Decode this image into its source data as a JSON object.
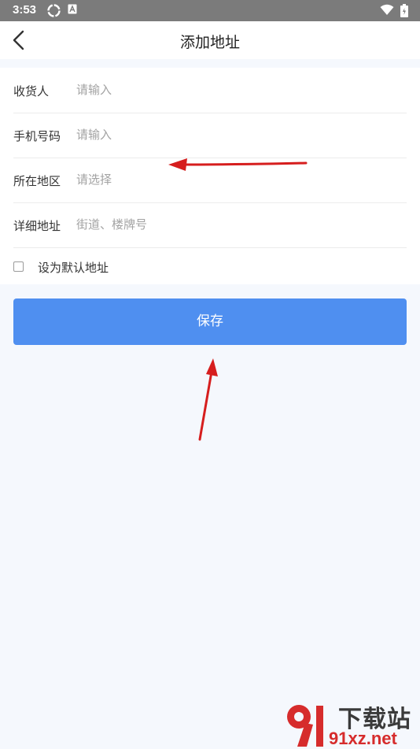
{
  "status_bar": {
    "time": "3:53"
  },
  "header": {
    "title": "添加地址"
  },
  "form": {
    "rows": [
      {
        "label": "收货人",
        "placeholder": "请输入"
      },
      {
        "label": "手机号码",
        "placeholder": "请输入"
      },
      {
        "label": "所在地区",
        "placeholder": "请选择"
      },
      {
        "label": "详细地址",
        "placeholder": "街道、楼牌号"
      }
    ],
    "default_address_label": "设为默认地址",
    "default_checked": false
  },
  "actions": {
    "save_label": "保存"
  },
  "watermark": {
    "top": "下载站",
    "bottom": "91xz.net"
  },
  "colors": {
    "primary": "#4f8ff0",
    "annotation_arrow": "#d61e1e",
    "status_bar": "#7b7b7b",
    "page_background": "#f5f8fd"
  }
}
